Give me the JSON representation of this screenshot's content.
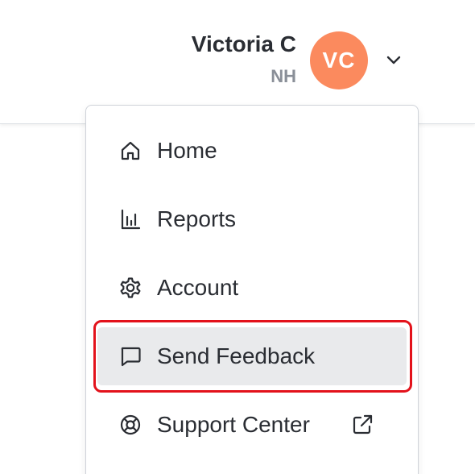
{
  "header": {
    "user_name": "Victoria C",
    "user_subtitle": "NH",
    "avatar_initials": "VC",
    "avatar_color": "#fb8a5e"
  },
  "menu": {
    "items": [
      {
        "label": "Home",
        "icon": "home-icon"
      },
      {
        "label": "Reports",
        "icon": "bar-chart-icon"
      },
      {
        "label": "Account",
        "icon": "gear-icon"
      },
      {
        "label": "Send Feedback",
        "icon": "chat-bubble-icon",
        "highlighted": true
      },
      {
        "label": "Support Center",
        "icon": "lifebuoy-icon",
        "trailing_icon": "external-link-icon"
      }
    ]
  },
  "colors": {
    "highlight_ring": "#e3121b",
    "highlight_bg": "#e9eaec",
    "text": "#2a2d33",
    "muted_text": "#8a8f98"
  }
}
